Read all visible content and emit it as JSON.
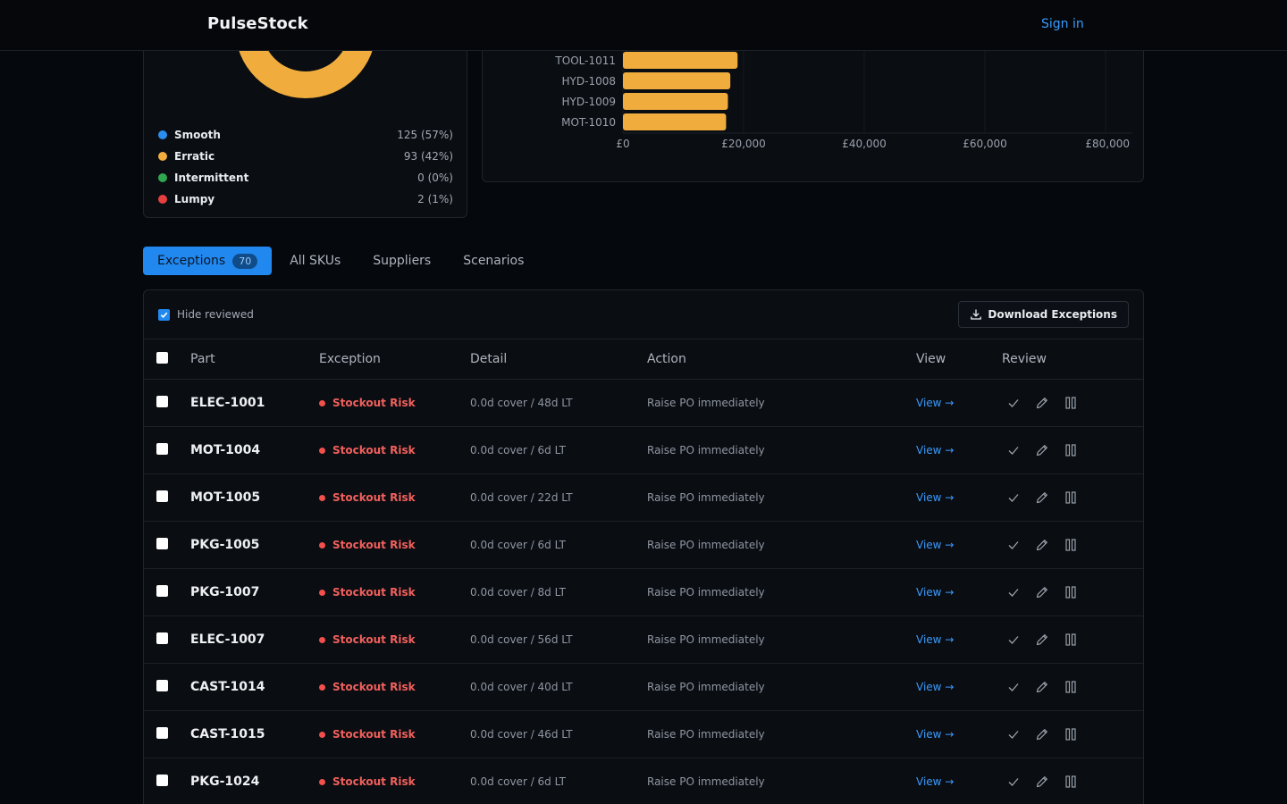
{
  "brand": "PulseStock",
  "signin_label": "Sign in",
  "donut": {
    "legend": [
      {
        "name": "Smooth",
        "value": "125 (57%)",
        "color": "#2a8ef0"
      },
      {
        "name": "Erratic",
        "value": "93 (42%)",
        "color": "#f0ad3e"
      },
      {
        "name": "Intermittent",
        "value": "0 (0%)",
        "color": "#2fa84f"
      },
      {
        "name": "Lumpy",
        "value": "2 (1%)",
        "color": "#e5403f"
      }
    ]
  },
  "chart_data": {
    "type": "bar",
    "orientation": "horizontal",
    "categories": [
      "TOOL-1011",
      "HYD-1008",
      "HYD-1009",
      "MOT-1010"
    ],
    "values": [
      19000,
      17800,
      17400,
      17100
    ],
    "xlim": [
      0,
      80000
    ],
    "xticks": [
      "£0",
      "£20,000",
      "£40,000",
      "£60,000",
      "£80,000"
    ],
    "bar_color": "#f0ad3e",
    "grid": true
  },
  "tabs": [
    {
      "label": "Exceptions",
      "badge": "70",
      "active": true
    },
    {
      "label": "All SKUs",
      "active": false
    },
    {
      "label": "Suppliers",
      "active": false
    },
    {
      "label": "Scenarios",
      "active": false
    }
  ],
  "toolbar": {
    "hide_reviewed_label": "Hide reviewed",
    "hide_reviewed_checked": true,
    "download_label": "Download Exceptions"
  },
  "table": {
    "columns": [
      "Part",
      "Exception",
      "Detail",
      "Action",
      "View",
      "Review"
    ],
    "rows": [
      {
        "part": "ELEC-1001",
        "exception": "Stockout Risk",
        "detail": "0.0d cover / 48d LT",
        "action": "Raise PO immediately",
        "view": "View →"
      },
      {
        "part": "MOT-1004",
        "exception": "Stockout Risk",
        "detail": "0.0d cover / 6d LT",
        "action": "Raise PO immediately",
        "view": "View →"
      },
      {
        "part": "MOT-1005",
        "exception": "Stockout Risk",
        "detail": "0.0d cover / 22d LT",
        "action": "Raise PO immediately",
        "view": "View →"
      },
      {
        "part": "PKG-1005",
        "exception": "Stockout Risk",
        "detail": "0.0d cover / 6d LT",
        "action": "Raise PO immediately",
        "view": "View →"
      },
      {
        "part": "PKG-1007",
        "exception": "Stockout Risk",
        "detail": "0.0d cover / 8d LT",
        "action": "Raise PO immediately",
        "view": "View →"
      },
      {
        "part": "ELEC-1007",
        "exception": "Stockout Risk",
        "detail": "0.0d cover / 56d LT",
        "action": "Raise PO immediately",
        "view": "View →"
      },
      {
        "part": "CAST-1014",
        "exception": "Stockout Risk",
        "detail": "0.0d cover / 40d LT",
        "action": "Raise PO immediately",
        "view": "View →"
      },
      {
        "part": "CAST-1015",
        "exception": "Stockout Risk",
        "detail": "0.0d cover / 46d LT",
        "action": "Raise PO immediately",
        "view": "View →"
      },
      {
        "part": "PKG-1024",
        "exception": "Stockout Risk",
        "detail": "0.0d cover / 6d LT",
        "action": "Raise PO immediately",
        "view": "View →"
      }
    ]
  }
}
